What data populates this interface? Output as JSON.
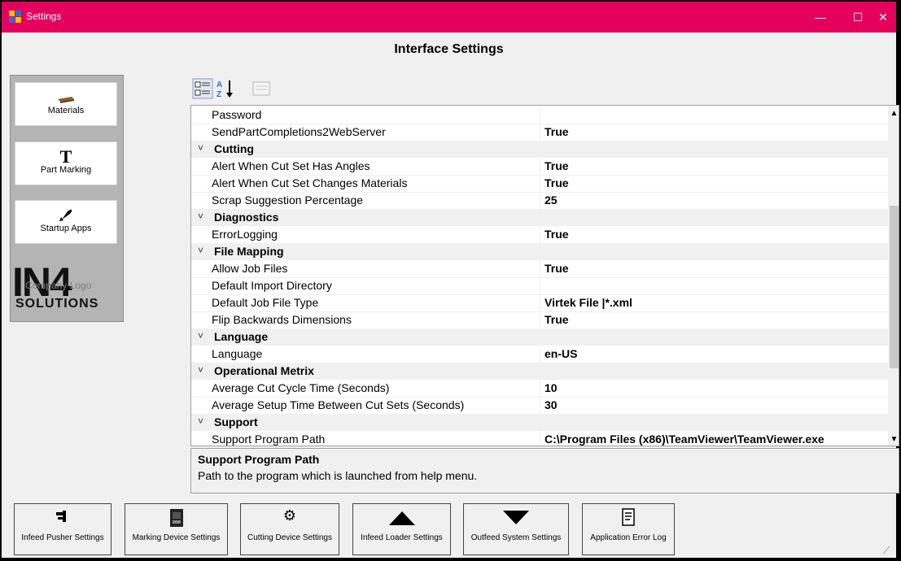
{
  "window": {
    "title": "Settings",
    "heading": "Interface Settings"
  },
  "nav": [
    {
      "label": "Materials",
      "icon": "lumber-icon"
    },
    {
      "label": "Part Marking",
      "icon": "text-t-icon"
    },
    {
      "label": "Startup Apps",
      "icon": "rocket-icon"
    }
  ],
  "logo": {
    "main": "IN4",
    "sub": "SOLUTIONS",
    "overlay": "Company Logo"
  },
  "grid": {
    "rows": [
      {
        "type": "prop",
        "name": "Password",
        "value": ""
      },
      {
        "type": "prop",
        "name": "SendPartCompletions2WebServer",
        "value": "True"
      },
      {
        "type": "cat",
        "name": "Cutting"
      },
      {
        "type": "prop",
        "name": "Alert When Cut Set Has Angles",
        "value": "True"
      },
      {
        "type": "prop",
        "name": "Alert When Cut Set Changes Materials",
        "value": "True"
      },
      {
        "type": "prop",
        "name": "Scrap Suggestion Percentage",
        "value": "25"
      },
      {
        "type": "cat",
        "name": "Diagnostics"
      },
      {
        "type": "prop",
        "name": "ErrorLogging",
        "value": "True"
      },
      {
        "type": "cat",
        "name": "File Mapping"
      },
      {
        "type": "prop",
        "name": "Allow Job Files",
        "value": "True"
      },
      {
        "type": "prop",
        "name": "Default Import Directory",
        "value": ""
      },
      {
        "type": "prop",
        "name": "Default Job File Type",
        "value": "Virtek File |*.xml"
      },
      {
        "type": "prop",
        "name": "Flip Backwards Dimensions",
        "value": "True"
      },
      {
        "type": "cat",
        "name": "Language"
      },
      {
        "type": "prop",
        "name": "Language",
        "value": "en-US"
      },
      {
        "type": "cat",
        "name": "Operational Metrix"
      },
      {
        "type": "prop",
        "name": "Average Cut Cycle Time (Seconds)",
        "value": "10"
      },
      {
        "type": "prop",
        "name": "Average Setup Time Between Cut Sets (Seconds)",
        "value": "30"
      },
      {
        "type": "cat",
        "name": "Support"
      },
      {
        "type": "prop",
        "name": "Support Program Path",
        "value": "C:\\Program Files (x86)\\TeamViewer\\TeamViewer.exe"
      }
    ]
  },
  "description": {
    "title": "Support Program Path",
    "text": "Path to the program which is launched from help menu."
  },
  "bottom_buttons": [
    {
      "label": "Infeed Pusher Settings",
      "icon": "pusher-icon"
    },
    {
      "label": "Marking Device Settings",
      "icon": "printer-icon"
    },
    {
      "label": "Cutting Device Settings",
      "icon": "gear-icon"
    },
    {
      "label": "Infeed Loader Settings",
      "icon": "triangle-up-icon"
    },
    {
      "label": "Outfeed System Settings",
      "icon": "triangle-down-icon"
    },
    {
      "label": "Application Error Log",
      "icon": "document-icon"
    }
  ],
  "colors": {
    "titlebar": "#e5005d"
  }
}
